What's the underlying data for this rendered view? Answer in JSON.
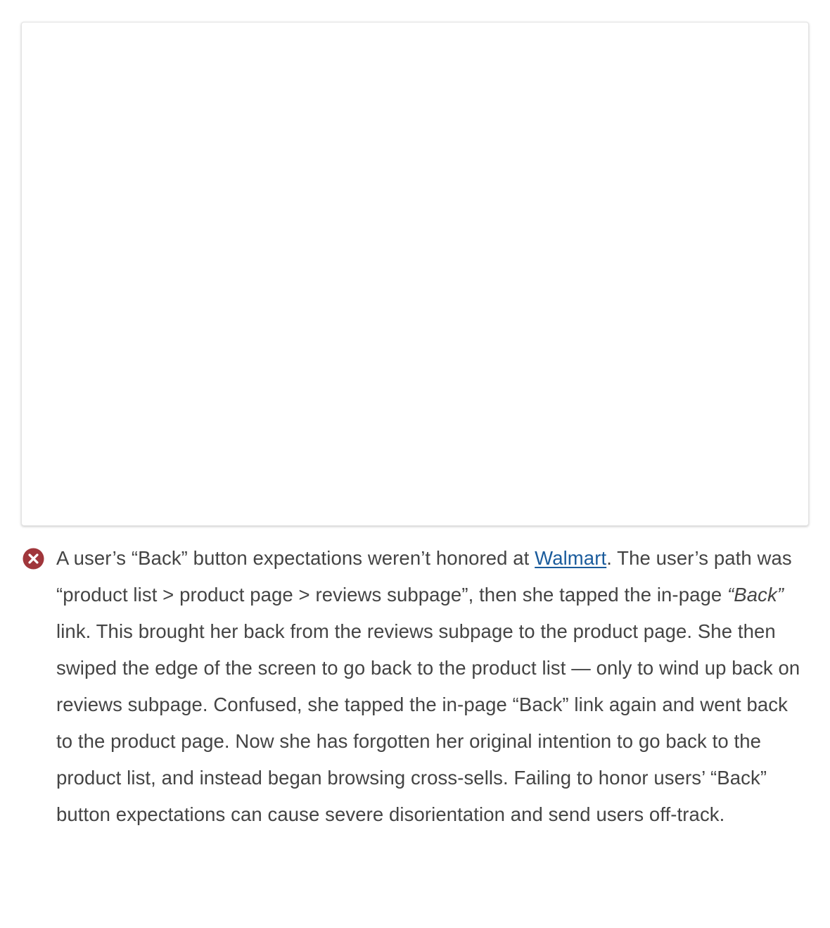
{
  "figure": {
    "image_content": ""
  },
  "caption": {
    "icon": "close-circle-icon",
    "icon_color": "#a0363b",
    "link_color": "#1b5c9c",
    "text_color": "#444444",
    "part1": "A user’s “Back” button expectations weren’t honored at ",
    "link_text": "Walmart",
    "part2": ". The user’s path was “product list > product page > reviews subpage”, then she tapped the in-page ",
    "emphasis": "“Back”",
    "part3": " link. This brought her back from the reviews subpage to the product page. She then swiped the edge of the screen to go back to the product list — only to wind up back on reviews subpage. Confused, she tapped the in-page “Back” link again and went back to the product page. Now she has forgotten her original intention to go back to the product list, and instead began browsing cross-sells. Failing to honor users’ “Back” button expectations can cause severe disorientation and send users off-track."
  }
}
